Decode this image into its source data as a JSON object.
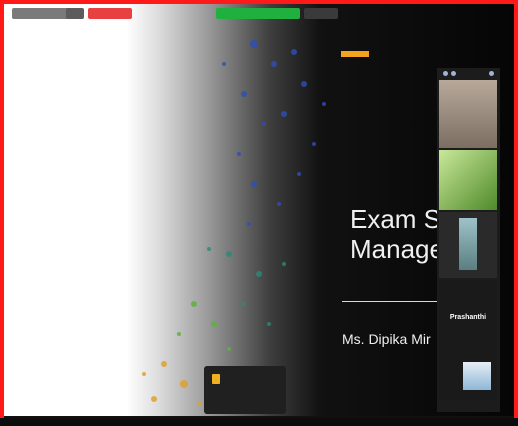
{
  "meeting": {
    "top_pills": [
      "",
      "",
      "",
      "",
      "",
      ""
    ],
    "slide": {
      "title_line1": "Exam S",
      "title_line2": "Manage",
      "presenter": "Ms. Dipika Mir",
      "accent_color": "#f4a41c"
    },
    "gallery": {
      "tile3_name": "",
      "tile4_label": "Prashanthi"
    },
    "popup": {
      "text": "",
      "button": ""
    }
  }
}
